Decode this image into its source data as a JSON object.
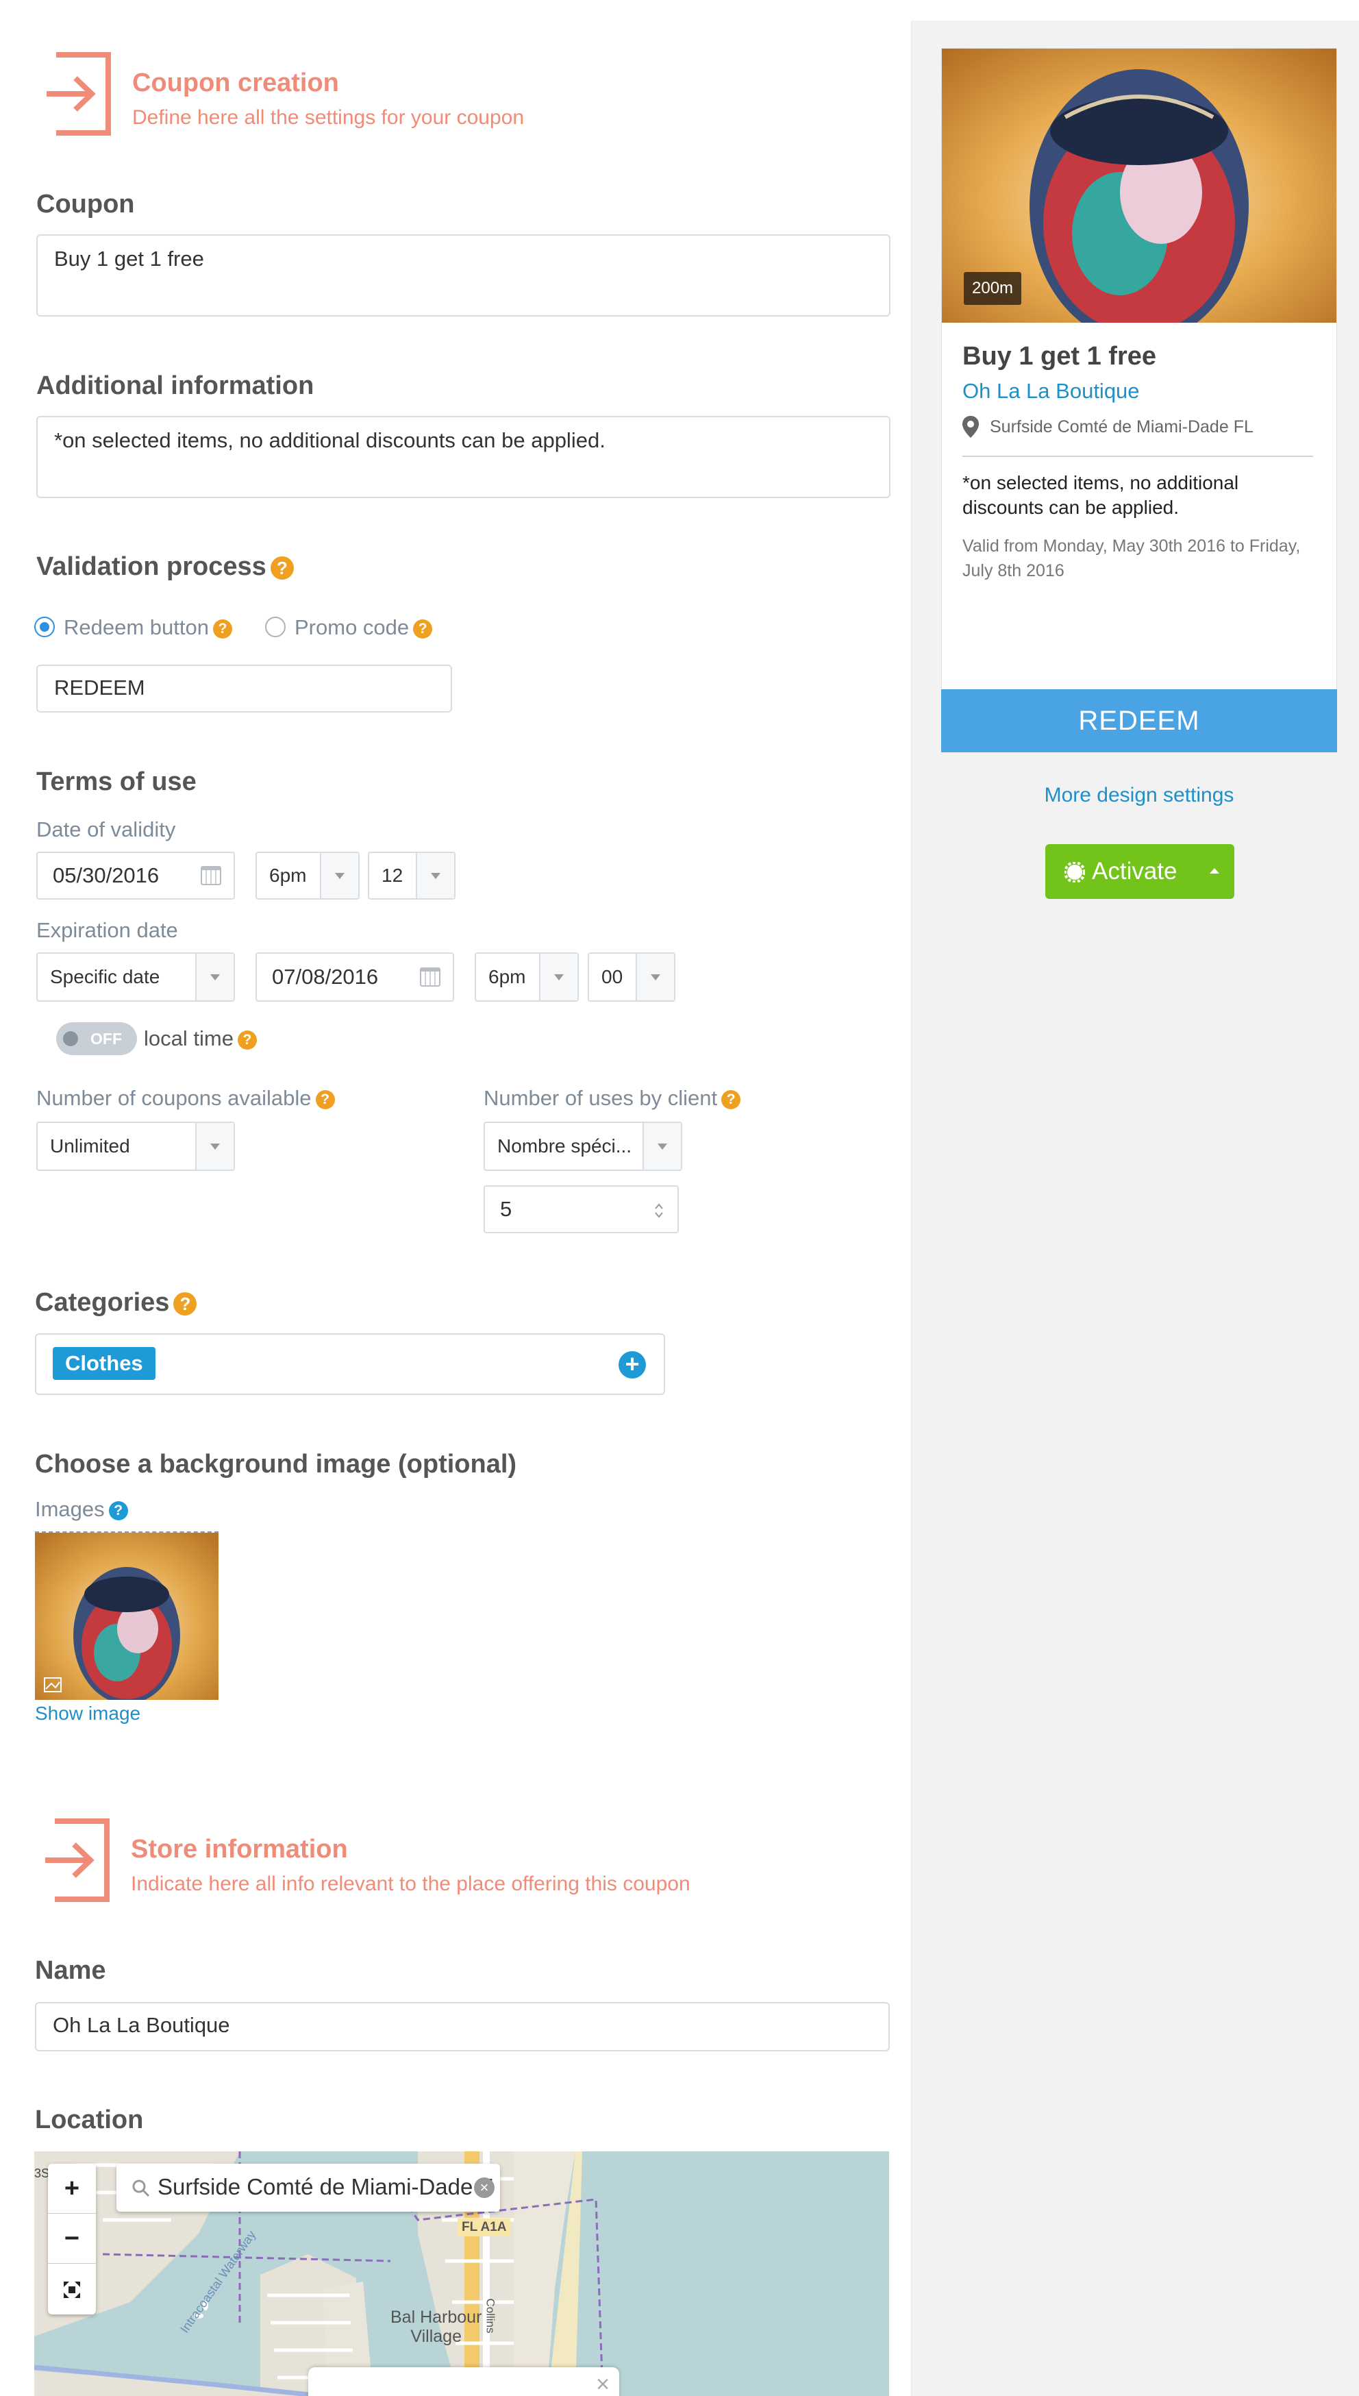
{
  "coupon_creation": {
    "title": "Coupon creation",
    "subtitle": "Define here all the settings for your coupon"
  },
  "coupon": {
    "label": "Coupon",
    "value": "Buy 1 get 1 free"
  },
  "additional_info": {
    "label": "Additional information",
    "value": "*on selected items, no additional discounts can be applied."
  },
  "validation": {
    "label": "Validation process",
    "option_redeem": "Redeem button",
    "option_promo": "Promo code",
    "selected": "Redeem button",
    "button_text": "REDEEM"
  },
  "terms": {
    "label": "Terms of use",
    "validity_label": "Date of validity",
    "validity_date": "05/30/2016",
    "validity_hour": "6pm",
    "validity_minute": "12",
    "expiration_label": "Expiration date",
    "expiration_type": "Specific date",
    "expiration_date": "07/08/2016",
    "expiration_hour": "6pm",
    "expiration_minute": "00",
    "toggle_state": "OFF",
    "toggle_label": "local time",
    "coupons_available_label": "Number of coupons available",
    "coupons_available_value": "Unlimited",
    "uses_by_client_label": "Number of uses by client",
    "uses_by_client_value": "Nombre spéci...",
    "uses_by_client_number": "5"
  },
  "categories": {
    "label": "Categories",
    "items": [
      "Clothes"
    ]
  },
  "background": {
    "label": "Choose a background image (optional)",
    "images_label": "Images",
    "show_image": "Show image"
  },
  "store_information": {
    "title": "Store information",
    "subtitle": "Indicate here all info relevant to the place offering this coupon"
  },
  "store": {
    "name_label": "Name",
    "name_value": "Oh La La Boutique",
    "location_label": "Location",
    "location_search": "Surfside Comté de Miami-Dade F"
  },
  "map": {
    "zoom_in": "+",
    "zoom_out": "−",
    "labels": {
      "road": "FL A1A",
      "place_line1": "Bal Harbour",
      "place_line2": "Village",
      "street": "Collins",
      "waterway": "Intracoastal Waterway",
      "edge": "3S"
    }
  },
  "preview": {
    "distance": "200m",
    "title": "Buy 1 get 1 free",
    "store_name": "Oh La La Boutique",
    "address": "Surfside Comté de Miami-Dade FL",
    "info": "*on selected items, no additional discounts can be applied.",
    "validity": "Valid from Monday, May 30th 2016 to Friday, July 8th 2016",
    "redeem_button": "REDEEM",
    "more_design": "More design settings",
    "activate": "Activate"
  },
  "colors": {
    "accent_salmon": "#f08b78",
    "link_blue": "#1e90c8",
    "redeem_blue": "#4aa3e3",
    "activate_green": "#72c41a",
    "help_orange": "#f0a020"
  }
}
